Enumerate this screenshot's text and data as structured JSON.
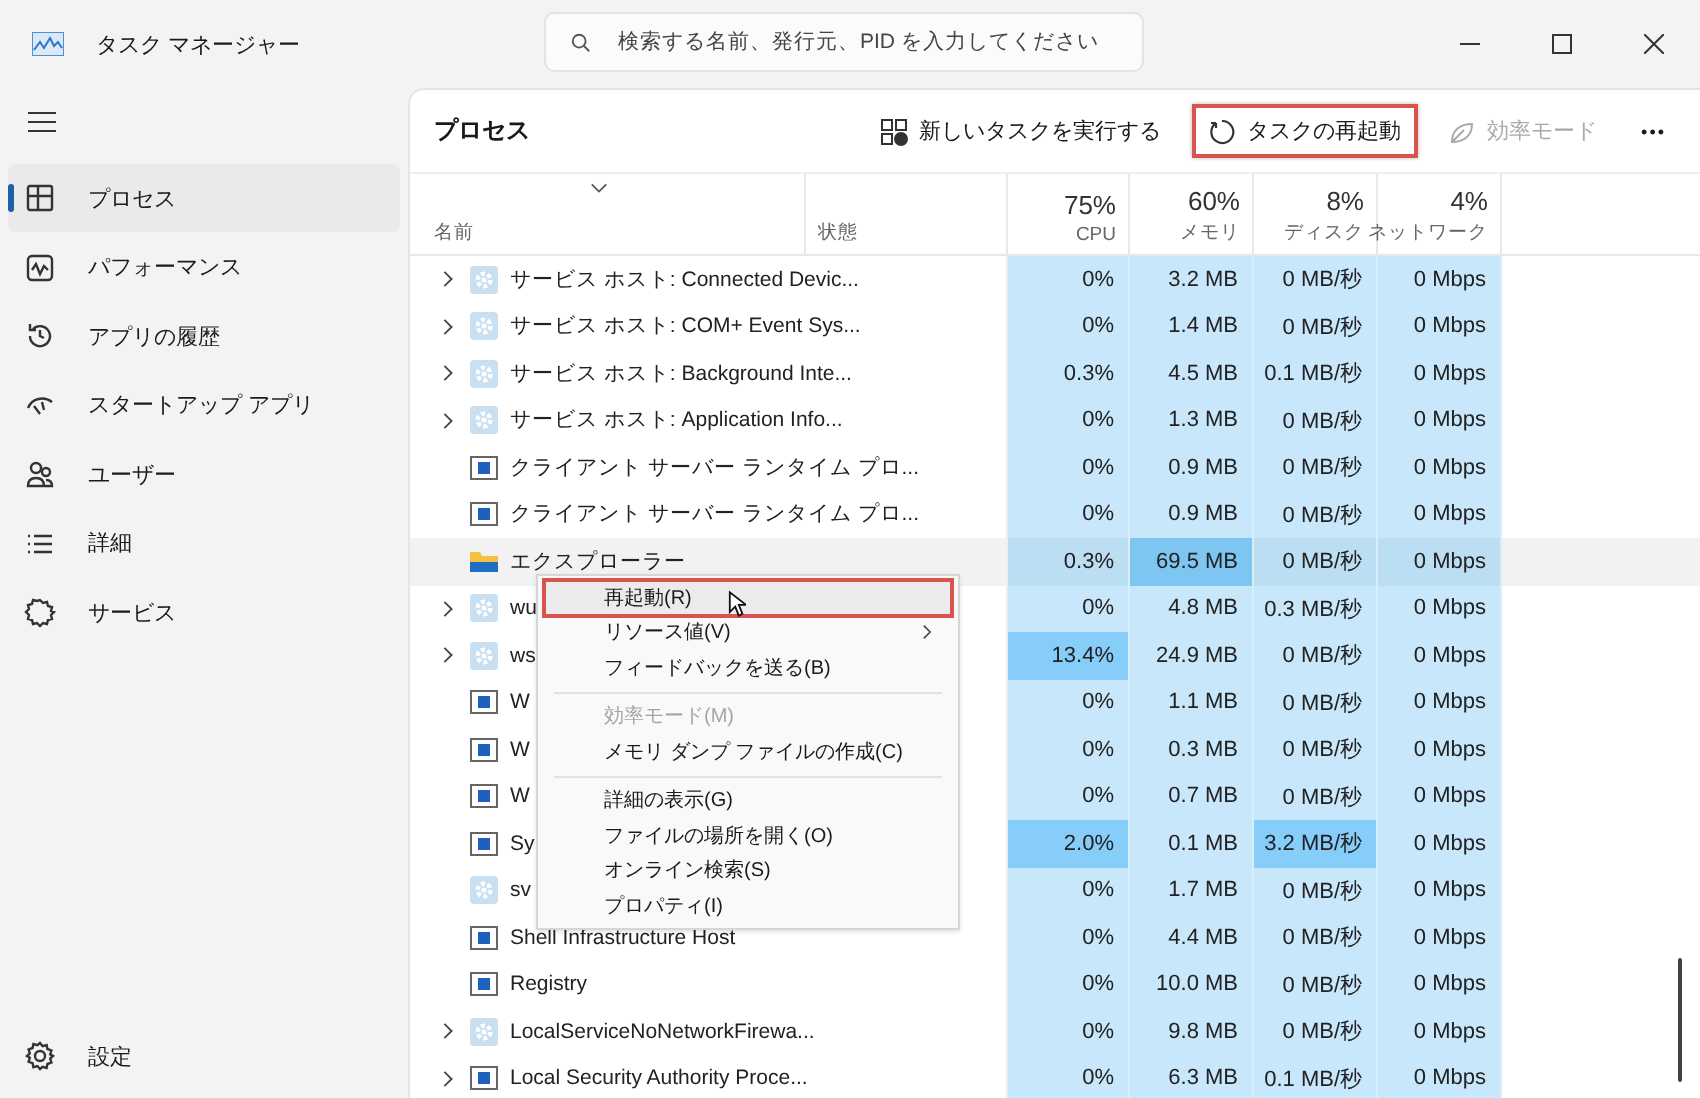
{
  "window": {
    "title": "タスク マネージャー"
  },
  "search": {
    "placeholder": "検索する名前、発行元、PID を入力してください"
  },
  "sidebar": {
    "items": [
      {
        "label": "プロセス",
        "kind": "processes",
        "selected": true
      },
      {
        "label": "パフォーマンス",
        "kind": "performance",
        "selected": false
      },
      {
        "label": "アプリの履歴",
        "kind": "history",
        "selected": false
      },
      {
        "label": "スタートアップ アプリ",
        "kind": "startup",
        "selected": false
      },
      {
        "label": "ユーザー",
        "kind": "users",
        "selected": false
      },
      {
        "label": "詳細",
        "kind": "details",
        "selected": false
      },
      {
        "label": "サービス",
        "kind": "services",
        "selected": false
      }
    ],
    "settings": "設定"
  },
  "page_title": "プロセス",
  "toolbar": [
    {
      "kind": "newtask",
      "label": "新しいタスクを実行する",
      "disabled": false,
      "annotated": false
    },
    {
      "kind": "restart",
      "label": "タスクの再起動",
      "disabled": false,
      "annotated": true
    },
    {
      "kind": "efficiency",
      "label": "効率モード",
      "disabled": true,
      "annotated": false
    },
    {
      "kind": "more",
      "label": "•••",
      "disabled": false,
      "annotated": false
    }
  ],
  "table": {
    "columns": [
      {
        "label": "名前"
      },
      {
        "label": "状態"
      },
      {
        "label": "CPU",
        "usage": "75%"
      },
      {
        "label": "メモリ",
        "usage": "60%"
      },
      {
        "label": "ディスク",
        "usage": "8%"
      },
      {
        "label": "ネットワーク",
        "usage": "4%"
      }
    ],
    "rows": [
      {
        "name": "サービス ホスト: Connected Devic...",
        "kind": "gear",
        "expandable": true,
        "selected": false,
        "cpu": "0%",
        "memory": "3.2 MB",
        "disk": "0 MB/秒",
        "network": "0 Mbps",
        "cpu_high": false,
        "memory_high": false,
        "disk_high": false
      },
      {
        "name": "サービス ホスト: COM+ Event Sys...",
        "kind": "gear",
        "expandable": true,
        "selected": false,
        "cpu": "0%",
        "memory": "1.4 MB",
        "disk": "0 MB/秒",
        "network": "0 Mbps",
        "cpu_high": false,
        "memory_high": false,
        "disk_high": false
      },
      {
        "name": "サービス ホスト: Background Inte...",
        "kind": "gear",
        "expandable": true,
        "selected": false,
        "cpu": "0.3%",
        "memory": "4.5 MB",
        "disk": "0.1 MB/秒",
        "network": "0 Mbps",
        "cpu_high": false,
        "memory_high": false,
        "disk_high": false
      },
      {
        "name": "サービス ホスト: Application Info...",
        "kind": "gear",
        "expandable": true,
        "selected": false,
        "cpu": "0%",
        "memory": "1.3 MB",
        "disk": "0 MB/秒",
        "network": "0 Mbps",
        "cpu_high": false,
        "memory_high": false,
        "disk_high": false
      },
      {
        "name": "クライアント サーバー ランタイム プロ...",
        "kind": "window",
        "expandable": false,
        "selected": false,
        "cpu": "0%",
        "memory": "0.9 MB",
        "disk": "0 MB/秒",
        "network": "0 Mbps",
        "cpu_high": false,
        "memory_high": false,
        "disk_high": false
      },
      {
        "name": "クライアント サーバー ランタイム プロ...",
        "kind": "window",
        "expandable": false,
        "selected": false,
        "cpu": "0%",
        "memory": "0.9 MB",
        "disk": "0 MB/秒",
        "network": "0 Mbps",
        "cpu_high": false,
        "memory_high": false,
        "disk_high": false
      },
      {
        "name": "エクスプローラー",
        "kind": "folder",
        "expandable": false,
        "selected": true,
        "cpu": "0.3%",
        "memory": "69.5 MB",
        "disk": "0 MB/秒",
        "network": "0 Mbps",
        "cpu_high": false,
        "memory_high": true,
        "disk_high": false
      },
      {
        "name": "wu",
        "kind": "gear",
        "expandable": true,
        "selected": false,
        "cpu": "0%",
        "memory": "4.8 MB",
        "disk": "0.3 MB/秒",
        "network": "0 Mbps",
        "cpu_high": false,
        "memory_high": false,
        "disk_high": false
      },
      {
        "name": "ws",
        "kind": "gear",
        "expandable": true,
        "selected": false,
        "cpu": "13.4%",
        "memory": "24.9 MB",
        "disk": "0 MB/秒",
        "network": "0 Mbps",
        "cpu_high": true,
        "memory_high": false,
        "disk_high": false
      },
      {
        "name": "W",
        "kind": "window",
        "expandable": false,
        "selected": false,
        "cpu": "0%",
        "memory": "1.1 MB",
        "disk": "0 MB/秒",
        "network": "0 Mbps",
        "cpu_high": false,
        "memory_high": false,
        "disk_high": false
      },
      {
        "name": "W",
        "kind": "window",
        "expandable": false,
        "selected": false,
        "cpu": "0%",
        "memory": "0.3 MB",
        "disk": "0 MB/秒",
        "network": "0 Mbps",
        "cpu_high": false,
        "memory_high": false,
        "disk_high": false
      },
      {
        "name": "W",
        "kind": "window",
        "expandable": false,
        "selected": false,
        "cpu": "0%",
        "memory": "0.7 MB",
        "disk": "0 MB/秒",
        "network": "0 Mbps",
        "cpu_high": false,
        "memory_high": false,
        "disk_high": false
      },
      {
        "name": "Sy",
        "kind": "window",
        "expandable": false,
        "selected": false,
        "cpu": "2.0%",
        "memory": "0.1 MB",
        "disk": "3.2 MB/秒",
        "network": "0 Mbps",
        "cpu_high": true,
        "memory_high": false,
        "disk_high": true
      },
      {
        "name": "sv",
        "kind": "gear",
        "expandable": false,
        "selected": false,
        "cpu": "0%",
        "memory": "1.7 MB",
        "disk": "0 MB/秒",
        "network": "0 Mbps",
        "cpu_high": false,
        "memory_high": false,
        "disk_high": false
      },
      {
        "name": "Shell Infrastructure Host",
        "kind": "window",
        "expandable": false,
        "selected": false,
        "cpu": "0%",
        "memory": "4.4 MB",
        "disk": "0 MB/秒",
        "network": "0 Mbps",
        "cpu_high": false,
        "memory_high": false,
        "disk_high": false
      },
      {
        "name": "Registry",
        "kind": "window",
        "expandable": false,
        "selected": false,
        "cpu": "0%",
        "memory": "10.0 MB",
        "disk": "0 MB/秒",
        "network": "0 Mbps",
        "cpu_high": false,
        "memory_high": false,
        "disk_high": false
      },
      {
        "name": "LocalServiceNoNetworkFirewa...",
        "kind": "gear",
        "expandable": true,
        "selected": false,
        "cpu": "0%",
        "memory": "9.8 MB",
        "disk": "0 MB/秒",
        "network": "0 Mbps",
        "cpu_high": false,
        "memory_high": false,
        "disk_high": false
      },
      {
        "name": "Local Security Authority Proce...",
        "kind": "window",
        "expandable": true,
        "selected": false,
        "cpu": "0%",
        "memory": "6.3 MB",
        "disk": "0.1 MB/秒",
        "network": "0 Mbps",
        "cpu_high": false,
        "memory_high": false,
        "disk_high": false
      }
    ]
  },
  "context_menu": [
    {
      "kind": "item",
      "label": "再起動(R)",
      "selected": true,
      "disabled": false,
      "annotated": true,
      "submenu": false
    },
    {
      "kind": "item",
      "label": "リソース値(V)",
      "selected": false,
      "disabled": false,
      "annotated": false,
      "submenu": true
    },
    {
      "kind": "item",
      "label": "フィードバックを送る(B)",
      "selected": false,
      "disabled": false,
      "annotated": false,
      "submenu": false
    },
    {
      "kind": "separator"
    },
    {
      "kind": "item",
      "label": "効率モード(M)",
      "selected": false,
      "disabled": true,
      "annotated": false,
      "submenu": false
    },
    {
      "kind": "item",
      "label": "メモリ ダンプ ファイルの作成(C)",
      "selected": false,
      "disabled": false,
      "annotated": false,
      "submenu": false
    },
    {
      "kind": "separator"
    },
    {
      "kind": "item",
      "label": "詳細の表示(G)",
      "selected": false,
      "disabled": false,
      "annotated": false,
      "submenu": false
    },
    {
      "kind": "item",
      "label": "ファイルの場所を開く(O)",
      "selected": false,
      "disabled": false,
      "annotated": false,
      "submenu": false
    },
    {
      "kind": "item",
      "label": "オンライン検索(S)",
      "selected": false,
      "disabled": false,
      "annotated": false,
      "submenu": false
    },
    {
      "kind": "item",
      "label": "プロパティ(I)",
      "selected": false,
      "disabled": false,
      "annotated": false,
      "submenu": false
    }
  ]
}
